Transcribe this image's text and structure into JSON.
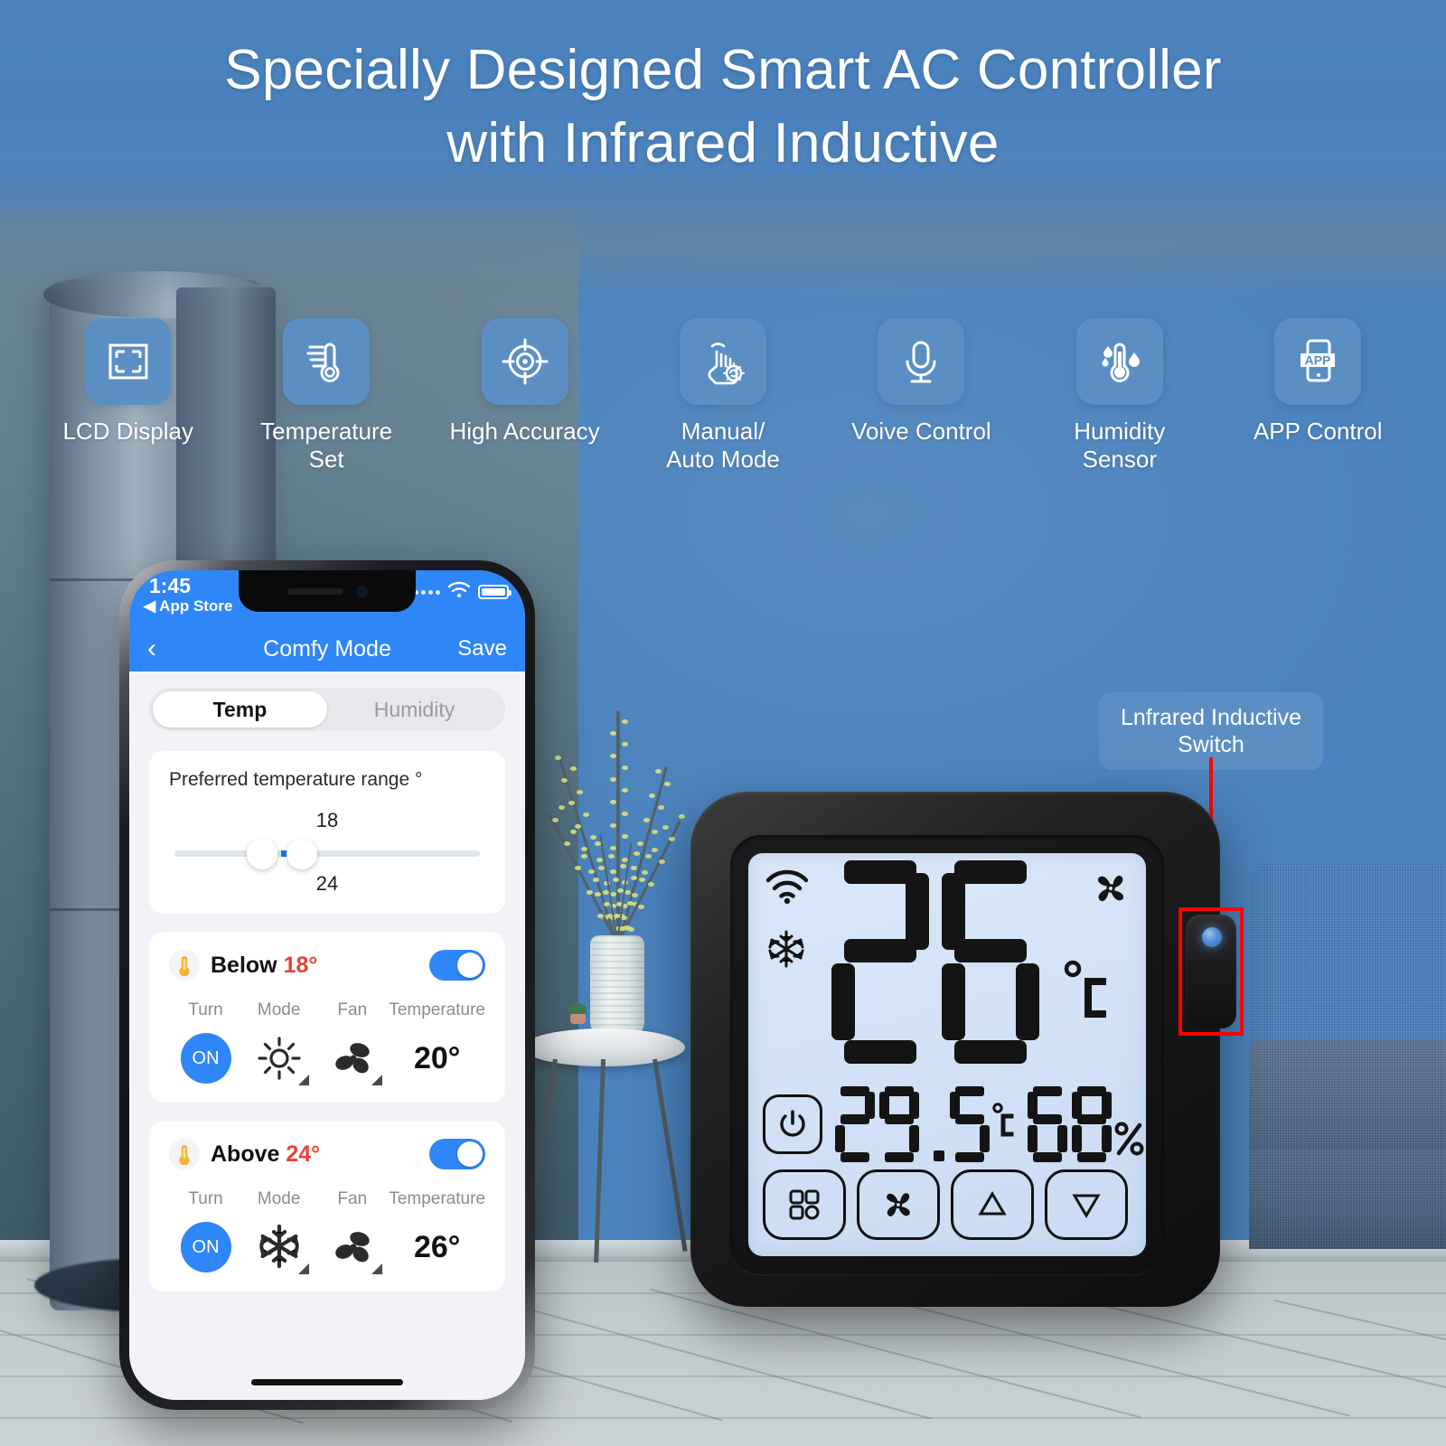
{
  "headline": {
    "line1": "Specially Designed Smart AC Controller",
    "line2": "with Infrared Inductive"
  },
  "colors": {
    "brand_blue": "#5b8fc4",
    "header_blue": "#4a82bd",
    "ios_blue": "#2f86f7",
    "alert_red": "#e8413a",
    "callout_red": "#ff0000",
    "lcd_bg": "#d6e3f8",
    "lcd_ink": "#141414"
  },
  "features": [
    {
      "label": "LCD Display",
      "icon": "lcd-display-icon"
    },
    {
      "label": "Temperature Set",
      "icon": "thermometer-set-icon"
    },
    {
      "label": "High Accuracy",
      "icon": "crosshair-target-icon"
    },
    {
      "label": "Manual/\nAuto Mode",
      "label_line1": "Manual/",
      "label_line2": "Auto Mode",
      "icon": "hand-tap-auto-icon"
    },
    {
      "label": "Voive Control",
      "icon": "microphone-icon"
    },
    {
      "label": "Humidity Sensor",
      "icon": "humidity-thermometer-icon"
    },
    {
      "label": "APP Control",
      "icon": "app-phone-icon"
    }
  ],
  "callout": {
    "line1": "Lnfrared Inductive",
    "line2": "Switch"
  },
  "phone": {
    "status": {
      "time": "1:45",
      "back_app": "App Store",
      "wifi_icon": "wifi-icon",
      "battery_icon": "battery-icon"
    },
    "nav": {
      "back_icon": "chevron-left-icon",
      "title": "Comfy Mode",
      "save_label": "Save"
    },
    "tabs": [
      {
        "label": "Temp",
        "active": true
      },
      {
        "label": "Humidity",
        "active": false
      }
    ],
    "range_card": {
      "title": "Preferred temperature range °",
      "min": "18",
      "max": "24"
    },
    "conditions": [
      {
        "icon": "thermometer-emoji-icon",
        "prefix": "Below",
        "value": "18°",
        "toggle_on": true,
        "columns": [
          {
            "head": "Turn",
            "value": "ON",
            "type": "pill"
          },
          {
            "head": "Mode",
            "value": "",
            "type": "icon",
            "icon": "sun-heat-icon"
          },
          {
            "head": "Fan",
            "value": "",
            "type": "icon",
            "icon": "fan-blades-icon"
          },
          {
            "head": "Temperature",
            "value": "20°",
            "type": "text"
          }
        ]
      },
      {
        "icon": "thermometer-emoji-icon",
        "prefix": "Above",
        "value": "24°",
        "toggle_on": true,
        "columns": [
          {
            "head": "Turn",
            "value": "ON",
            "type": "pill"
          },
          {
            "head": "Mode",
            "value": "",
            "type": "icon",
            "icon": "snowflake-cool-icon"
          },
          {
            "head": "Fan",
            "value": "",
            "type": "icon",
            "icon": "fan-blades-icon"
          },
          {
            "head": "Temperature",
            "value": "26°",
            "type": "text"
          }
        ]
      }
    ]
  },
  "device": {
    "lcd": {
      "wifi_icon": "wifi-icon",
      "mode_icon": "snowflake-icon",
      "fan_icon": "fan-icon",
      "set_temp": "26",
      "set_temp_unit": "°C",
      "ambient_temp": "29.5",
      "ambient_unit": "°C",
      "humidity": "68",
      "humidity_unit": "%",
      "power_icon": "power-icon",
      "buttons": [
        {
          "icon": "mode-grid-icon"
        },
        {
          "icon": "fan-speed-icon"
        },
        {
          "icon": "up-arrow-icon"
        },
        {
          "icon": "down-arrow-icon"
        }
      ]
    }
  }
}
